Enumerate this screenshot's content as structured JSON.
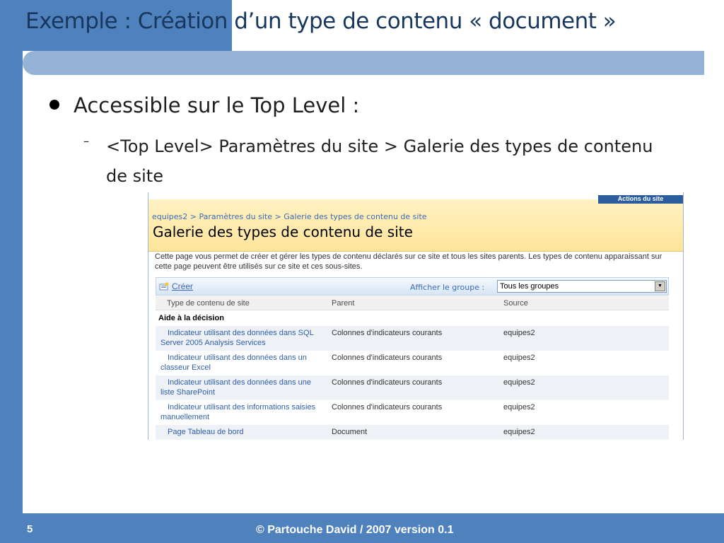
{
  "slide": {
    "title": "Exemple : Création d’un type de contenu « document »",
    "bullet1": "Accessible sur le Top Level :",
    "bullet2_dash": "–",
    "bullet2": "<Top Level> Paramètres du site > Galerie des types de contenu de site",
    "page_number": "5",
    "footer": "© Partouche David / 2007 version 0.1"
  },
  "screenshot": {
    "actions_tab": "Actions du site",
    "breadcrumb": "equipes2 > Paramètres du site > Galerie des types de contenu de site",
    "heading": "Galerie des types de contenu de site",
    "description": "Cette page vous permet de créer et gérer les types de contenu déclarés sur ce site et tous les sites parents. Les types de contenu apparaissant sur cette page peuvent être utilisés sur ce site et ces sous-sites.",
    "toolbar": {
      "create_label": "Créer",
      "group_label": "Afficher le groupe :",
      "group_selected": "Tous les groupes",
      "arrow": "▼"
    },
    "table": {
      "columns": [
        "Type de contenu de site",
        "Parent",
        "Source"
      ],
      "group": "Aide à la décision",
      "rows": [
        {
          "name": "Indicateur utilisant des données dans SQL Server 2005 Analysis Services",
          "parent": "Colonnes d'indicateurs courants",
          "source": "equipes2"
        },
        {
          "name": "Indicateur utilisant des données dans un classeur Excel",
          "parent": "Colonnes d'indicateurs courants",
          "source": "equipes2"
        },
        {
          "name": "Indicateur utilisant des données dans une liste SharePoint",
          "parent": "Colonnes d'indicateurs courants",
          "source": "equipes2"
        },
        {
          "name": "Indicateur utilisant des informations saisies manuellement",
          "parent": "Colonnes d'indicateurs courants",
          "source": "equipes2"
        },
        {
          "name": "Page Tableau de bord",
          "parent": "Document",
          "source": "equipes2"
        }
      ]
    }
  },
  "colors": {
    "accent": "#4f81bd",
    "band": "#95b3d7",
    "title": "#17375e",
    "link": "#3c6bb5"
  }
}
